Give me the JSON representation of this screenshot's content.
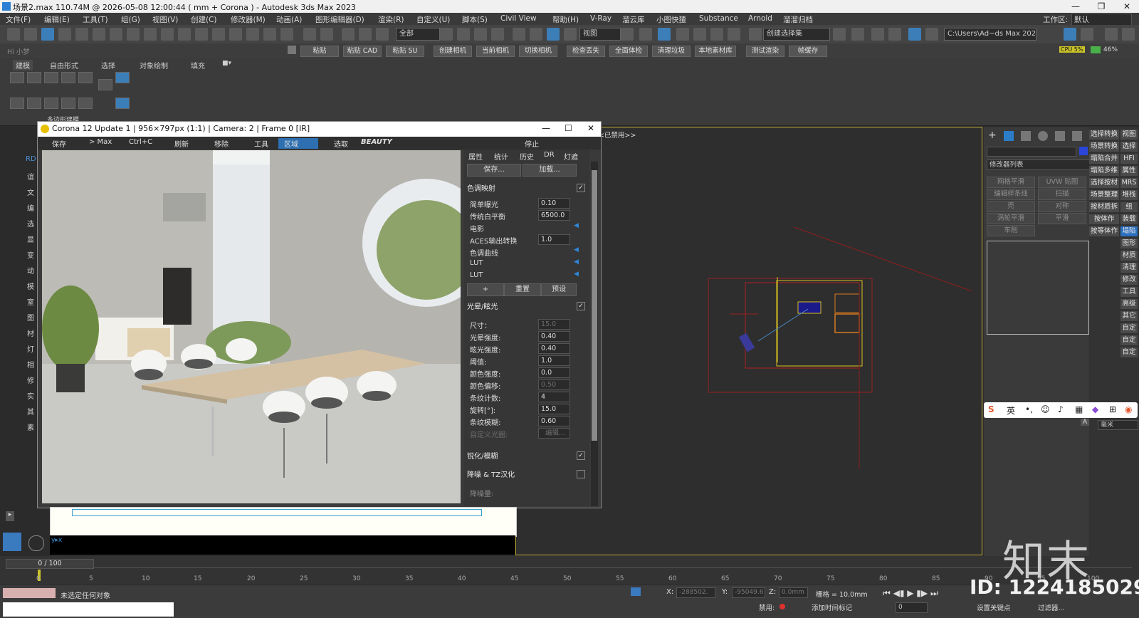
{
  "window": {
    "title": "场景2.max  110.74M @ 2026-05-08 12:00:44  ( mm + Corona ) - Autodesk 3ds Max 2023",
    "minimize": "—",
    "maximize": "❐",
    "close": "✕"
  },
  "menu": {
    "items": [
      "文件(F)",
      "编辑(E)",
      "工具(T)",
      "组(G)",
      "视图(V)",
      "创建(C)",
      "修改器(M)",
      "动画(A)",
      "图形编辑器(D)",
      "渲染(R)",
      "自定义(U)",
      "脚本(S)",
      "Civil View",
      "帮助(H)",
      "V-Ray",
      "溜云库",
      "小图快猹",
      "Substance",
      "Arnold",
      "溜溜归档"
    ],
    "workspace_label": "工作区:",
    "workspace_value": "默认"
  },
  "toolbar": {
    "selection_filter": "全部",
    "view_combo": "视图",
    "selection_set": "创建选择集",
    "path_combo": "C:\\Users\\Ad~ds Max 202..."
  },
  "quickbar": {
    "user": "Hi 小梦",
    "buttons": [
      "粘贴",
      "粘贴 CAD",
      "粘贴 SU",
      "创建相机",
      "当前相机",
      "切换相机",
      "检查丢失",
      "全面体检",
      "清理垃圾",
      "本地素材库",
      "测试渲染",
      "帧缓存"
    ],
    "cpu": "CPU 5%",
    "mem": "46%"
  },
  "ribbon": {
    "tabs": [
      "建模",
      "自由形式",
      "选择",
      "对象绘制",
      "填充"
    ],
    "group_label": "多边形建模"
  },
  "left_commands": [
    "RD",
    "谊",
    "文",
    "编",
    "选",
    "显",
    "变",
    "动",
    "模",
    "室",
    "图",
    "材",
    "灯",
    "相",
    "修",
    "实",
    "其",
    "素"
  ],
  "render_window": {
    "title": "Corona 12 Update 1 | 956×797px (1:1) | Camera: 2 | Frame 0 [IR]",
    "toolbar": [
      "保存",
      "> Max",
      "Ctrl+C",
      "刷新",
      "移除",
      "工具",
      "区域",
      "选取",
      "BEAUTY",
      "停止"
    ],
    "panel_tabs": [
      "属性",
      "统计",
      "历史",
      "DR",
      "灯遮"
    ],
    "save_btn": "保存...",
    "load_btn": "加载...",
    "tonemap": {
      "title": "色调映射",
      "checked": "✓",
      "rows": [
        {
          "label": "简单曝光",
          "value": "0.10"
        },
        {
          "label": "传统白平衡",
          "value": "6500.0"
        },
        {
          "label": "电影",
          "value": ""
        },
        {
          "label": "ACES输出转换",
          "value": "1.0"
        },
        {
          "label": "色调曲线",
          "value": ""
        },
        {
          "label": "LUT",
          "value": ""
        },
        {
          "label": "LUT",
          "value": ""
        }
      ],
      "plus": "+",
      "reset": "重置",
      "preset": "预设"
    },
    "bloom": {
      "title": "光晕/眩光",
      "rows": [
        {
          "label": "尺寸：",
          "value": "15.0",
          "dim": true
        },
        {
          "label": "光晕强度:",
          "value": "0.40"
        },
        {
          "label": "眩光强度:",
          "value": "0.40"
        },
        {
          "label": "阈值:",
          "value": "1.0"
        },
        {
          "label": "颜色强度:",
          "value": "0.0"
        },
        {
          "label": "颜色偏移:",
          "value": "0.50",
          "dim": true
        },
        {
          "label": "条纹计数:",
          "value": "4"
        },
        {
          "label": "旋转[°]:",
          "value": "15.0"
        },
        {
          "label": "条纹模糊:",
          "value": "0.60"
        }
      ],
      "custom_aperture": "自定义光圈:",
      "edit": "编辑..."
    },
    "sharpen": "锐化/模糊",
    "denoise": "降噪 & TZ汉化",
    "denoise_amount": "降噪量:"
  },
  "viewport": {
    "label": "<<已禁用>>"
  },
  "right_panel": {
    "tabs": [
      "+",
      "修改",
      "层次",
      "运动",
      "显示",
      "工具"
    ],
    "modifier_list": "修改器列表",
    "buttons": [
      "网格平滑",
      "UVW 贴图",
      "编辑样条线",
      "扫描",
      "壳",
      "对称",
      "涡轮平滑",
      "平滑",
      "车削"
    ],
    "unit": "毫米"
  },
  "right_column": [
    "选择转换",
    "视图",
    "场景转换",
    "选择",
    "塌陷合并",
    "HFI",
    "塌陷多维",
    "属性",
    "选择按材",
    "MRS",
    "场景整理",
    "堆栈",
    "按材质拆",
    "组",
    "按体作",
    "装载",
    "按等体作",
    "塌陷",
    "图形",
    "材质",
    "清理",
    "修改",
    "工具",
    "高级",
    "其它",
    "自定",
    "自定",
    "自定"
  ],
  "timeline": {
    "frame": "0 / 100",
    "ticks": [
      "0",
      "5",
      "10",
      "15",
      "20",
      "25",
      "30",
      "35",
      "40",
      "45",
      "50",
      "55",
      "60",
      "65",
      "70",
      "75",
      "80",
      "85",
      "90",
      "95",
      "100"
    ]
  },
  "status": {
    "message": "未选定任何对象",
    "x_label": "X:",
    "x_value": "-288502.",
    "y_label": "Y:",
    "y_value": "-95049.6",
    "z_label": "Z:",
    "z_value": "0.0mm",
    "grid": "栅格 = 10.0mm",
    "disabled": "禁用:",
    "add_time_tag": "添加时间标记",
    "set_key": "设置关键点",
    "filter": "过滤器...",
    "frame_spin": "0"
  },
  "ime": {
    "items": [
      "英"
    ]
  },
  "watermark": {
    "id": "ID: 1224185029",
    "logo": "知末"
  }
}
